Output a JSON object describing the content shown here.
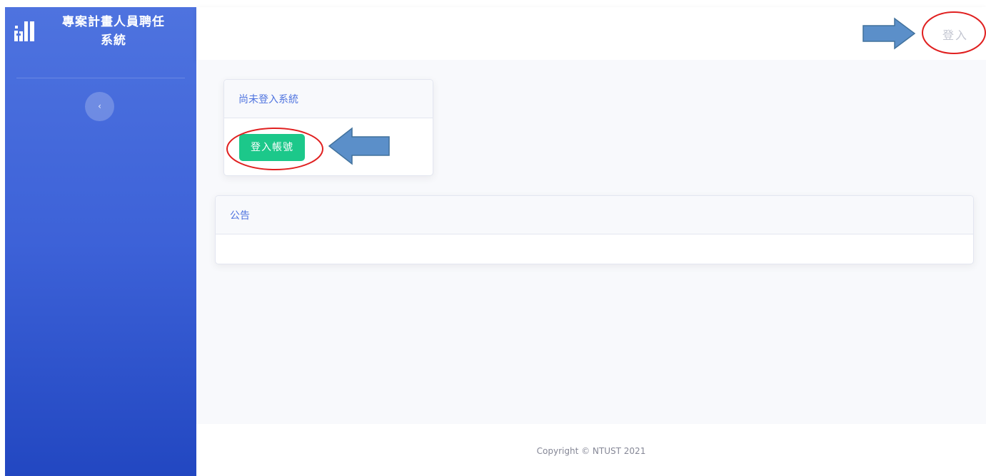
{
  "sidebar": {
    "brand_title": "專案計畫人員聘任系統",
    "brand_icon": "building-logo-icon",
    "toggle_label": "‹"
  },
  "topbar": {
    "login_label": "登入"
  },
  "login_card": {
    "title": "尚未登入系統",
    "button_label": "登入帳號"
  },
  "notice_card": {
    "title": "公告"
  },
  "footer": {
    "copyright": "Copyright © NTUST 2021"
  },
  "colors": {
    "sidebar_top": "#4e73df",
    "sidebar_bottom": "#2247c1",
    "primary": "#4e73df",
    "success": "#1cc88a",
    "annotation_arrow": "#5b8fc9",
    "annotation_circle": "#e02020"
  }
}
